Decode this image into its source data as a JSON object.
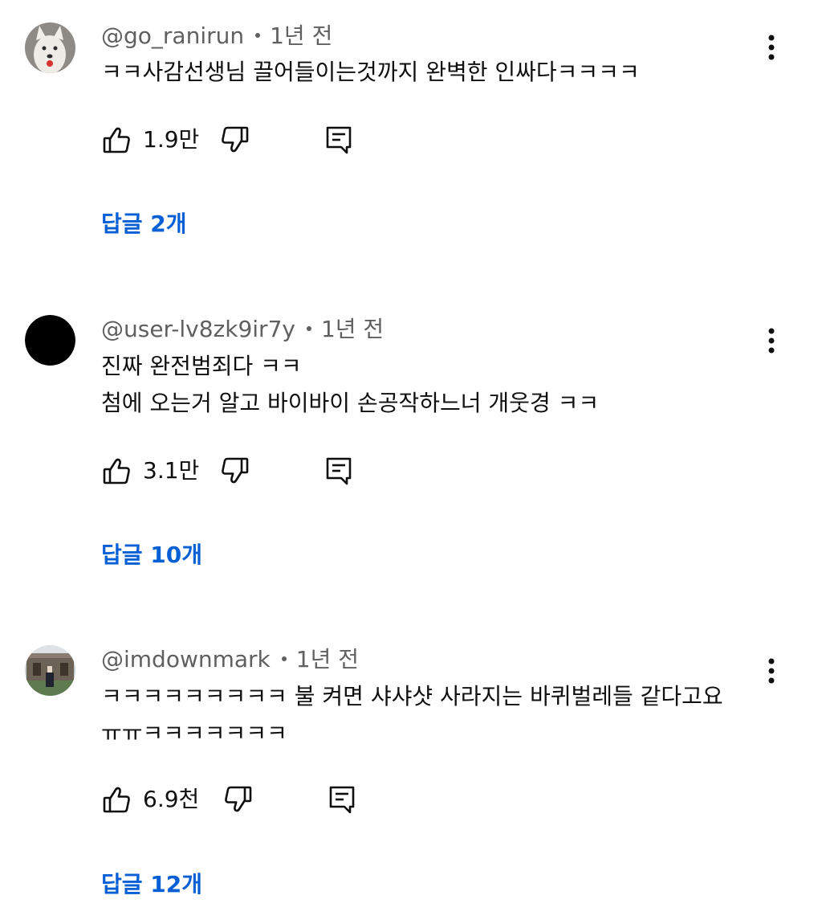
{
  "comments": [
    {
      "author": "@go_ranirun",
      "time": "1년 전",
      "lines": [
        "ㅋㅋ사감선생님 끌어들이는것까지 완벽한 인싸다ㅋㅋㅋㅋ"
      ],
      "likes": "1.9만",
      "replies": "답글 2개",
      "avatar": "white-dog-avatar"
    },
    {
      "author": "@user-lv8zk9ir7y",
      "time": "1년 전",
      "lines": [
        "진짜 완전범죄다 ㅋㅋ",
        "첨에 오는거 알고 바이바이 손공작하느너 개웃경 ㅋㅋ"
      ],
      "likes": "3.1만",
      "replies": "답글 10개",
      "avatar": "black-circle-avatar"
    },
    {
      "author": "@imdownmark",
      "time": "1년 전",
      "lines": [
        "ㅋㅋㅋㅋㅋㅋㅋㅋㅋ 불 켜면 샤샤샷 사라지는 바퀴벌레들 같다고요",
        "ㅠㅠㅋㅋㅋㅋㅋㅋㅋ"
      ],
      "likes": "6.9천",
      "replies": "답글 12개",
      "avatar": "outdoor-photo-avatar"
    }
  ],
  "icons": {
    "like": "thumbs-up-icon",
    "dislike": "thumbs-down-icon",
    "reply": "comment-reply-icon",
    "menu": "more-vertical-icon"
  },
  "colors": {
    "reply_link": "#065fd4",
    "meta_text": "#606060",
    "body_text": "#0f0f0f"
  }
}
